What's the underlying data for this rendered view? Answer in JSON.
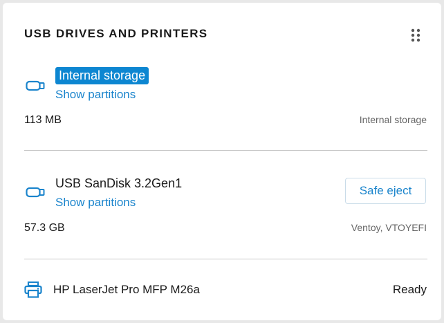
{
  "widget": {
    "title": "USB DRIVES AND PRINTERS",
    "menu_icon": "drag-handle-icon"
  },
  "drives": [
    {
      "icon": "usb-drive-icon",
      "name": "Internal storage",
      "link": "Show partitions",
      "size": "113 MB",
      "detail": "Internal storage"
    },
    {
      "icon": "usb-drive-icon",
      "name": "USB SanDisk 3.2Gen1",
      "link": "Show partitions",
      "size": "57.3 GB",
      "detail": "Ventoy, VTOYEFI",
      "action": "Safe eject"
    }
  ],
  "printer": {
    "icon": "printer-icon",
    "name": "HP LaserJet Pro MFP M26a",
    "status": "Ready"
  },
  "colors": {
    "accent": "#1a84cc",
    "selection": "#0d86d1"
  }
}
